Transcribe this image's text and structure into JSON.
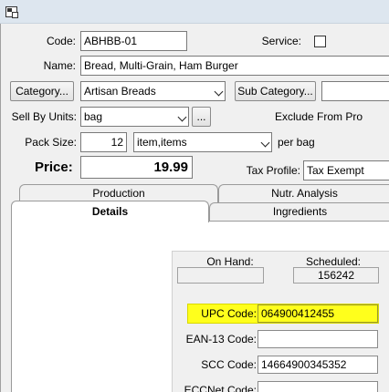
{
  "form": {
    "code_label": "Code:",
    "code_value": "ABHBB-01",
    "service_label": "Service:",
    "service_checked": false,
    "name_label": "Name:",
    "name_value": "Bread, Multi-Grain, Ham Burger",
    "category_button": "Category...",
    "category_value": "Artisan Breads",
    "subcategory_button": "Sub Category...",
    "subcategory_value": "",
    "sell_by_units_label": "Sell By Units:",
    "sell_by_units_value": "bag",
    "ellipsis_button": "...",
    "exclude_label": "Exclude From Pro",
    "pack_size_label": "Pack Size:",
    "pack_size_value": "12",
    "pack_unit_value": "item,items",
    "per_bag_label": "per bag",
    "price_label": "Price:",
    "price_value": "19.99",
    "tax_profile_label": "Tax Profile:",
    "tax_profile_value": "Tax Exempt"
  },
  "tabs": {
    "production": "Production",
    "nutr_analysis": "Nutr. Analysis",
    "details": "Details",
    "ingredients": "Ingredients"
  },
  "details": {
    "on_hand_label": "On Hand:",
    "on_hand_value": "",
    "scheduled_label": "Scheduled:",
    "scheduled_value": "156242",
    "upc_label": "UPC Code:",
    "upc_value": "064900412455",
    "ean_label": "EAN-13 Code:",
    "ean_value": "",
    "scc_label": "SCC Code:",
    "scc_value": "14664900345352",
    "eccnet_label": "ECCNet Code:",
    "eccnet_value": ""
  },
  "colors": {
    "highlight": "#ffff1c",
    "window_bg": "#f0f0f0",
    "titlebar_bg": "#dde6ef"
  }
}
